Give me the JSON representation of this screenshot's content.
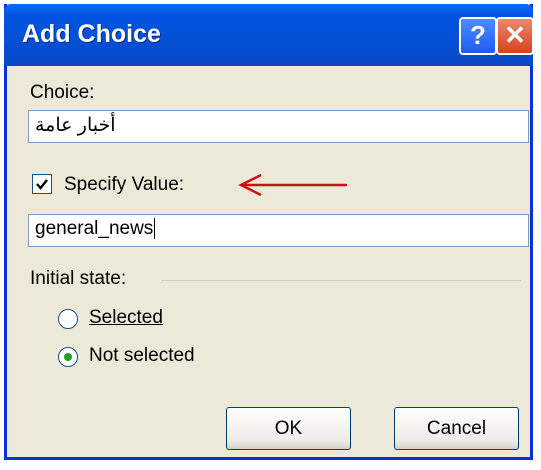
{
  "window": {
    "title": "Add Choice",
    "help_label": "?",
    "close_label": "✕"
  },
  "choice": {
    "label": "Choice:",
    "value": "أخبار عامة"
  },
  "specify_value": {
    "label": "Specify Value:",
    "checked": true,
    "value": "general_news"
  },
  "initial_state": {
    "label": "Initial state:",
    "options": [
      {
        "label": "Selected",
        "selected": false
      },
      {
        "label": "Not selected",
        "selected": true
      }
    ]
  },
  "buttons": {
    "ok": "OK",
    "cancel": "Cancel"
  },
  "annotation": {
    "icon": "red-arrow-icon",
    "color": "#cc1111"
  }
}
